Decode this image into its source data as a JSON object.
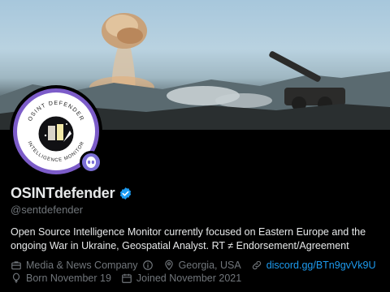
{
  "profile": {
    "display_name": "OSINTdefender",
    "handle": "@sentdefender",
    "verified": true,
    "bio": "Open Source Intelligence Monitor currently focused on Eastern Europe and the ongoing War in Ukraine, Geospatial Analyst. RT ≠ Endorsement/Agreement",
    "avatar_ring_text_top": "OSINT DEFENDER",
    "avatar_ring_text_bottom": "INTELLIGENCE MONITOR"
  },
  "meta": {
    "category": "Media & News Company",
    "location": "Georgia, USA",
    "link": "discord.gg/BTn9gvVk9U",
    "born": "Born November 19",
    "joined": "Joined November 2021"
  },
  "icons": {
    "category": "briefcase-icon",
    "info": "info-icon",
    "location": "location-pin-icon",
    "link": "link-icon",
    "born": "balloon-icon",
    "joined": "calendar-icon",
    "verified": "verified-badge-icon",
    "badge": "alien-badge-icon"
  },
  "colors": {
    "background": "#000000",
    "text": "#e7e9ea",
    "secondary_text": "#71767b",
    "link": "#1d9bf0",
    "verified": "#1d9bf0",
    "avatar_ring": "#7c5cc9"
  }
}
